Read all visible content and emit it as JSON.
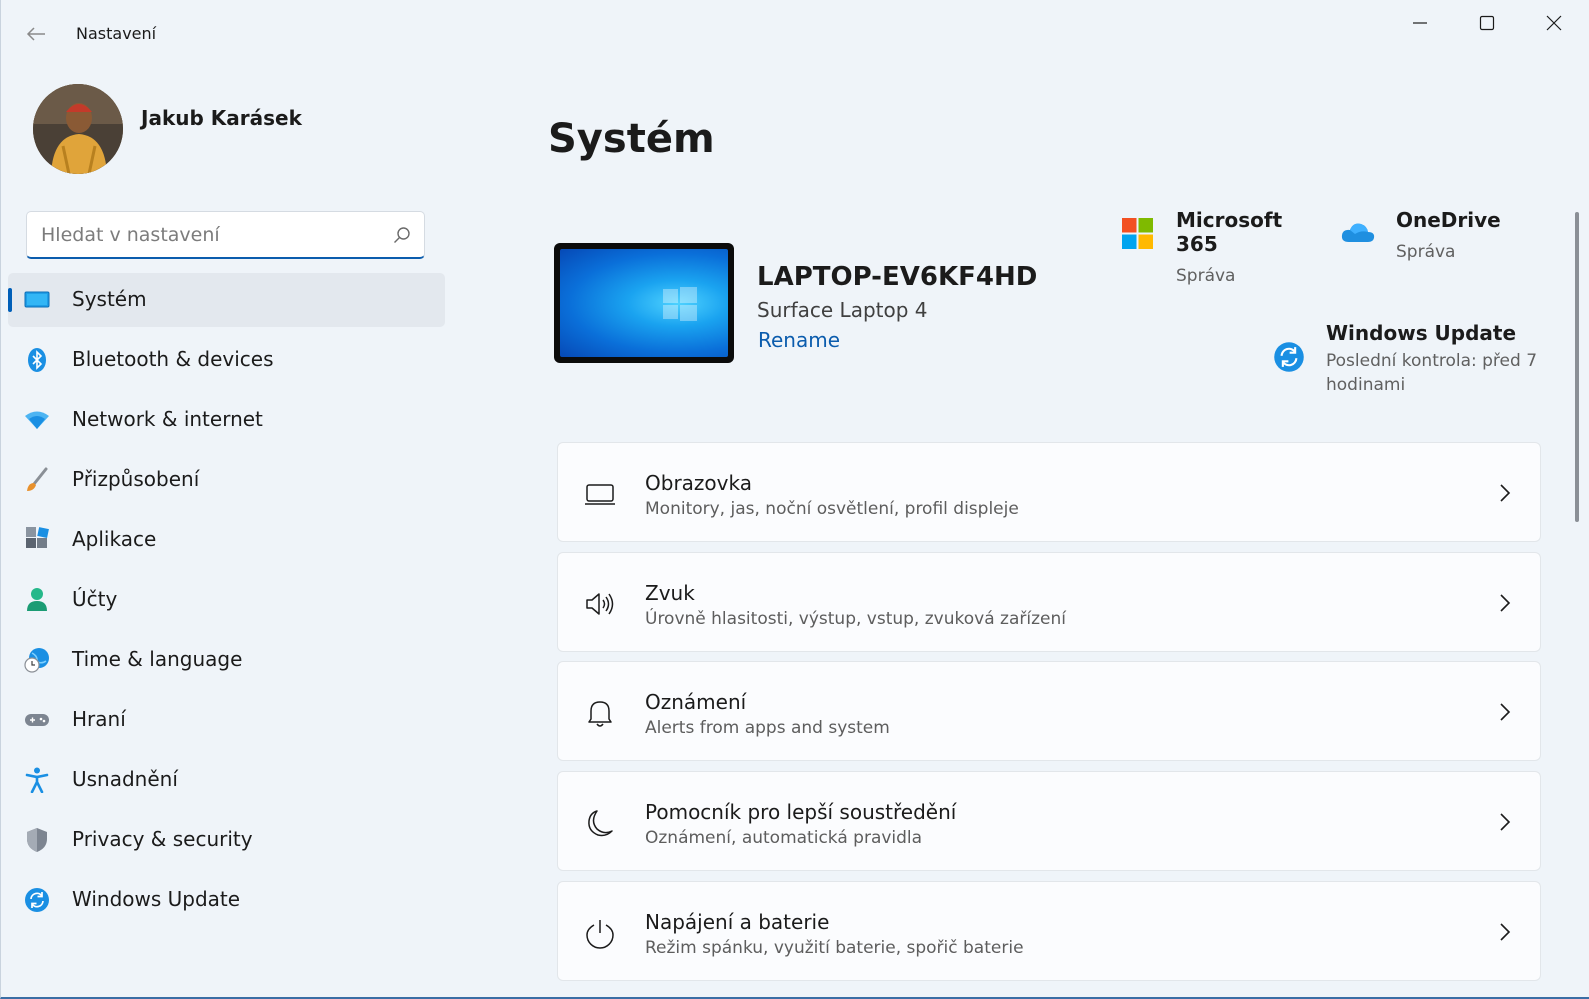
{
  "window": {
    "title": "Nastavení"
  },
  "profile": {
    "name": "Jakub Karásek"
  },
  "search": {
    "placeholder": "Hledat v nastavení"
  },
  "sidebar": {
    "items": [
      {
        "label": "Systém",
        "icon": "system-icon",
        "active": true
      },
      {
        "label": "Bluetooth & devices",
        "icon": "bluetooth-icon"
      },
      {
        "label": "Network & internet",
        "icon": "wifi-icon"
      },
      {
        "label": "Přizpůsobení",
        "icon": "brush-icon"
      },
      {
        "label": "Aplikace",
        "icon": "apps-icon"
      },
      {
        "label": "Účty",
        "icon": "person-icon"
      },
      {
        "label": "Time & language",
        "icon": "globe-clock-icon"
      },
      {
        "label": "Hraní",
        "icon": "gamepad-icon"
      },
      {
        "label": "Usnadnění",
        "icon": "accessibility-icon"
      },
      {
        "label": "Privacy & security",
        "icon": "shield-icon"
      },
      {
        "label": "Windows Update",
        "icon": "update-icon"
      }
    ]
  },
  "main": {
    "title": "Systém",
    "device": {
      "name": "LAPTOP-EV6KF4HD",
      "model": "Surface Laptop 4",
      "rename_label": "Rename"
    },
    "quick_links": {
      "m365": {
        "title": "Microsoft 365",
        "sub": "Správa",
        "icon": "microsoft-365-icon"
      },
      "onedrive": {
        "title": "OneDrive",
        "sub": "Správa",
        "icon": "onedrive-icon"
      },
      "update": {
        "title": "Windows Update",
        "sub": "Poslední kontrola: před 7 hodinami",
        "icon": "update-icon"
      }
    },
    "cards": [
      {
        "title": "Obrazovka",
        "sub": "Monitory, jas, noční osvětlení, profil displeje",
        "icon": "display-icon"
      },
      {
        "title": "Zvuk",
        "sub": "Úrovně hlasitosti, výstup, vstup, zvuková zařízení",
        "icon": "speaker-icon"
      },
      {
        "title": "Oznámení",
        "sub": "Alerts from apps and system",
        "icon": "bell-icon"
      },
      {
        "title": "Pomocník pro lepší soustředění",
        "sub": "Oznámení, automatická pravidla",
        "icon": "moon-icon"
      },
      {
        "title": "Napájení a baterie",
        "sub": "Režim spánku, využití baterie, spořič baterie",
        "icon": "power-icon"
      }
    ]
  },
  "colors": {
    "accent": "#005fb8",
    "link": "#0b5cad",
    "background": "#eff4f9",
    "card": "#fbfcfe"
  }
}
